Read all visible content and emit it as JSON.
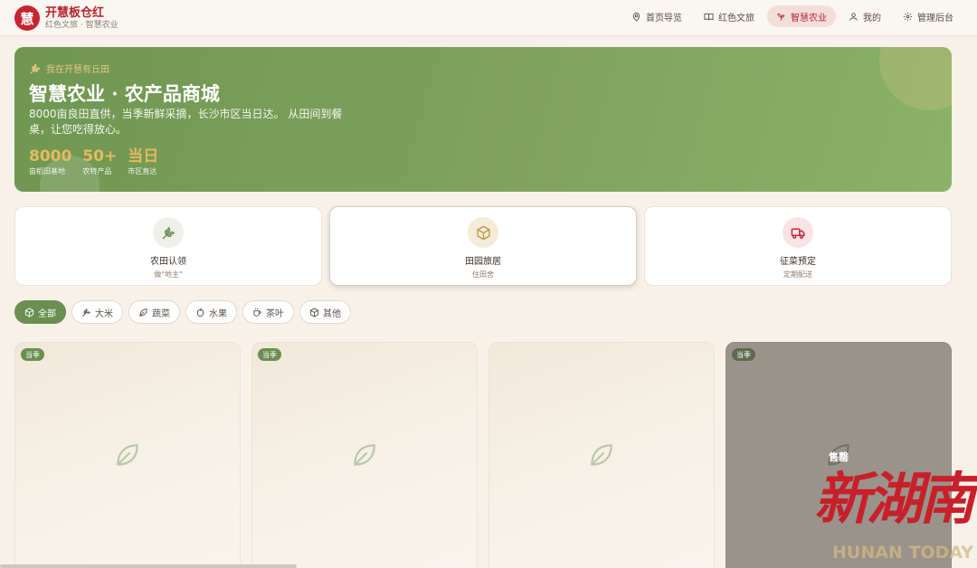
{
  "brand": {
    "logo_char": "慧",
    "title": "开慧板仓红",
    "subtitle": "红色文旅 · 智慧农业"
  },
  "nav": [
    {
      "label": "首页导览",
      "icon": "map-pin-icon"
    },
    {
      "label": "红色文旅",
      "icon": "book-open-icon"
    },
    {
      "label": "智慧农业",
      "icon": "sprout-icon",
      "active": true
    },
    {
      "label": "我的",
      "icon": "user-icon"
    },
    {
      "label": "管理后台",
      "icon": "gear-icon"
    }
  ],
  "hero": {
    "tag": "我在开慧有丘田",
    "title": "智慧农业 · 农产品商城",
    "desc": "8000亩良田直供，当季新鲜采摘，长沙市区当日达。 从田间到餐桌，让您吃得放心。",
    "stats": [
      {
        "value": "8000",
        "label": "亩稻田基地"
      },
      {
        "value": "50+",
        "label": "农特产品"
      },
      {
        "value": "当日",
        "label": "市区直达"
      }
    ]
  },
  "services": [
    {
      "title": "农田认领",
      "sub": "做\"地主\"",
      "icon": "wheat-icon"
    },
    {
      "title": "田园旅居",
      "sub": "住田舍",
      "icon": "package-icon"
    },
    {
      "title": "征菜预定",
      "sub": "定期配送",
      "icon": "truck-icon"
    }
  ],
  "categories": [
    {
      "label": "全部",
      "icon": "package-icon",
      "active": true
    },
    {
      "label": "大米",
      "icon": "wheat-icon"
    },
    {
      "label": "蔬菜",
      "icon": "leaf-icon"
    },
    {
      "label": "水果",
      "icon": "apple-icon"
    },
    {
      "label": "茶叶",
      "icon": "cup-icon"
    },
    {
      "label": "其他",
      "icon": "package-icon"
    }
  ],
  "products": [
    {
      "badge": "当季"
    },
    {
      "badge": "当季"
    },
    {
      "badge": ""
    },
    {
      "badge": "当季",
      "status": "售罄"
    }
  ],
  "watermark": {
    "main": "新湖南",
    "sub": "HUNAN TODAY"
  },
  "colors": {
    "brand_red": "#c8242f",
    "agri_green": "#6a8f50",
    "accent_gold": "#e6b85e",
    "background": "#f7f1ea"
  }
}
